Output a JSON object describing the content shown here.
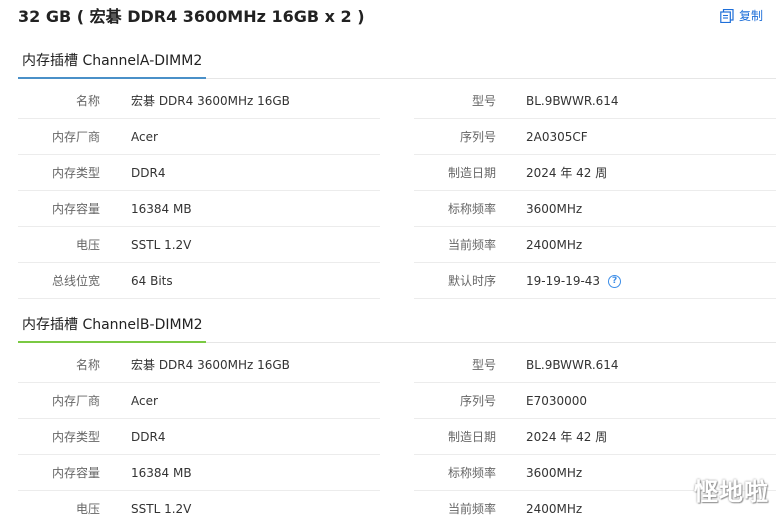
{
  "header": {
    "title": "32 GB ( 宏碁 DDR4 3600MHz 16GB x 2 )",
    "copy_label": "复制"
  },
  "colors": {
    "accent_blue": "#4a90c8",
    "accent_green": "#7ac943",
    "link": "#1e6fd9"
  },
  "sections": [
    {
      "title": "内存插槽 ChannelA-DIMM2",
      "rows": [
        {
          "k1": "名称",
          "v1": "宏碁 DDR4 3600MHz 16GB",
          "k2": "型号",
          "v2": "BL.9BWWR.614"
        },
        {
          "k1": "内存厂商",
          "v1": "Acer",
          "k2": "序列号",
          "v2": "2A0305CF"
        },
        {
          "k1": "内存类型",
          "v1": "DDR4",
          "k2": "制造日期",
          "v2": "2024 年 42 周"
        },
        {
          "k1": "内存容量",
          "v1": "16384 MB",
          "k2": "标称频率",
          "v2": "3600MHz"
        },
        {
          "k1": "电压",
          "v1": "SSTL 1.2V",
          "k2": "当前频率",
          "v2": "2400MHz"
        },
        {
          "k1": "总线位宽",
          "v1": "64 Bits",
          "k2": "默认时序",
          "v2": "19-19-19-43"
        }
      ]
    },
    {
      "title": "内存插槽 ChannelB-DIMM2",
      "rows": [
        {
          "k1": "名称",
          "v1": "宏碁 DDR4 3600MHz 16GB",
          "k2": "型号",
          "v2": "BL.9BWWR.614"
        },
        {
          "k1": "内存厂商",
          "v1": "Acer",
          "k2": "序列号",
          "v2": "E7030000"
        },
        {
          "k1": "内存类型",
          "v1": "DDR4",
          "k2": "制造日期",
          "v2": "2024 年 42 周"
        },
        {
          "k1": "内存容量",
          "v1": "16384 MB",
          "k2": "标称频率",
          "v2": "3600MHz"
        },
        {
          "k1": "电压",
          "v1": "SSTL 1.2V",
          "k2": "当前频率",
          "v2": "2400MHz"
        }
      ]
    }
  ],
  "watermark": "悭地啦"
}
